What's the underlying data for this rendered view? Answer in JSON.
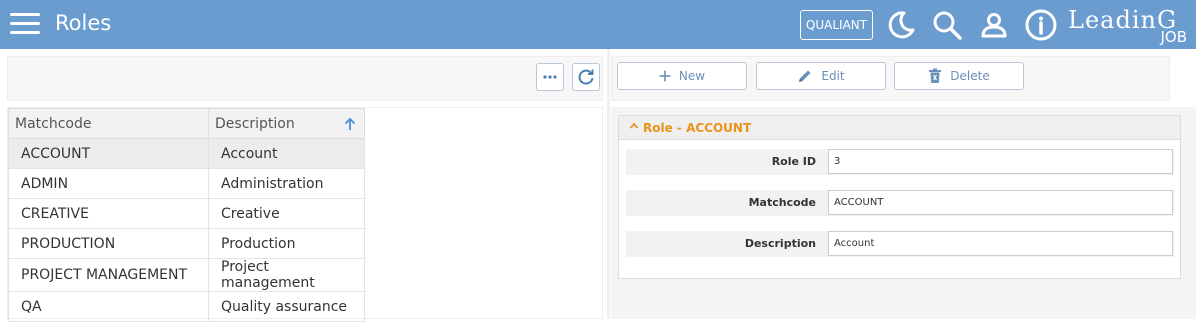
{
  "header": {
    "title": "Roles",
    "qualiant_label": "QUALIANT",
    "logo_line1": "LeadinG",
    "logo_line2": "JOB",
    "icons": [
      "menu-icon",
      "moon-icon",
      "search-icon",
      "user-icon",
      "info-icon"
    ],
    "background_color": "#6a9cd0"
  },
  "left_toolbar": {
    "icons": [
      "more-icon",
      "refresh-icon"
    ]
  },
  "table": {
    "columns": [
      "Matchcode",
      "Description"
    ],
    "sort_icon": "arrow-up-icon",
    "rows": [
      {
        "matchcode": "ACCOUNT",
        "description": "Account"
      },
      {
        "matchcode": "ADMIN",
        "description": "Administration"
      },
      {
        "matchcode": "CREATIVE",
        "description": "Creative"
      },
      {
        "matchcode": "PRODUCTION",
        "description": "Production"
      },
      {
        "matchcode": "PROJECT MANAGEMENT",
        "description": "Project management"
      },
      {
        "matchcode": "QA",
        "description": "Quality assurance"
      }
    ],
    "selected_row": 0
  },
  "actions": {
    "new_label": "New",
    "edit_label": "Edit",
    "delete_label": "Delete",
    "accent_color": "#6a8fb8"
  },
  "detail": {
    "title": "Role - ACCOUNT",
    "title_color": "#e8941a",
    "fields": [
      {
        "label": "Role ID",
        "value": "3"
      },
      {
        "label": "Matchcode",
        "value": "ACCOUNT"
      },
      {
        "label": "Description",
        "value": "Account"
      }
    ]
  }
}
